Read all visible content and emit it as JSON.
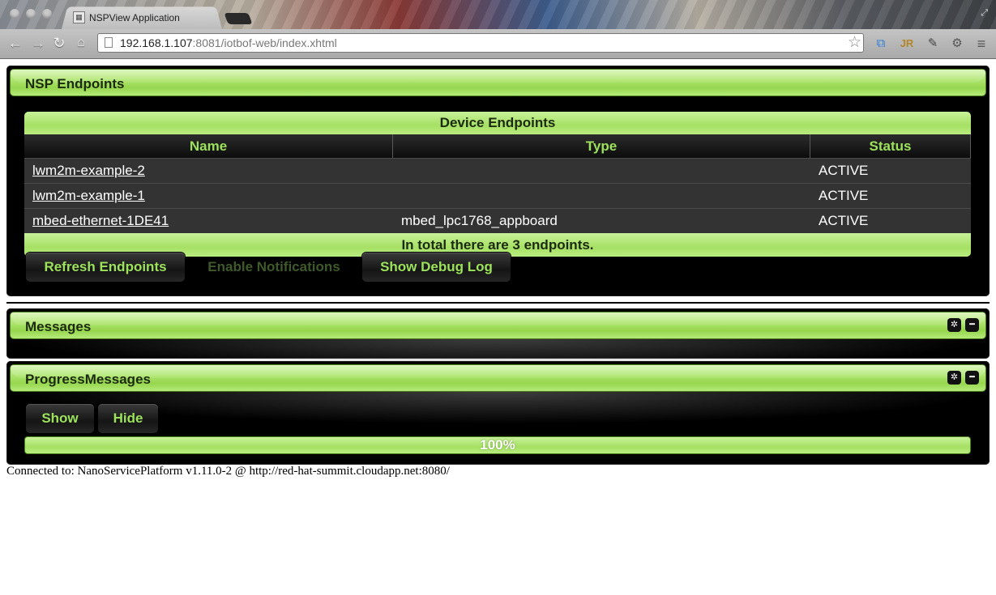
{
  "browser": {
    "tab_title": "NSPView Application",
    "url_host": "192.168.1.107",
    "url_rest": ":8081/iotbof-web/index.xhtml"
  },
  "endpoints_panel": {
    "title": "NSP Endpoints",
    "table_caption": "Device Endpoints",
    "columns": [
      "Name",
      "Type",
      "Status"
    ],
    "rows": [
      {
        "name": "lwm2m-example-2",
        "type": "",
        "status": "ACTIVE"
      },
      {
        "name": "lwm2m-example-1",
        "type": "",
        "status": "ACTIVE"
      },
      {
        "name": "mbed-ethernet-1DE41",
        "type": "mbed_lpc1768_appboard",
        "status": "ACTIVE"
      }
    ],
    "footer": "In total there are 3 endpoints.",
    "buttons": {
      "refresh": "Refresh Endpoints",
      "notifications": "Enable Notifications",
      "debug_log": "Show Debug Log"
    }
  },
  "messages_panel": {
    "title": "Messages"
  },
  "progress_panel": {
    "title": "ProgressMessages",
    "show_label": "Show",
    "hide_label": "Hide",
    "progress_text": "100%",
    "progress_value": 1.0
  },
  "status_line": "Connected to: NanoServicePlatform v1.11.0-2 @ http://red-hat-summit.cloudapp.net:8080/",
  "colors": {
    "accent_green": "#9ce25a",
    "header_green": "#aee56f",
    "panel_bg": "#000000"
  },
  "icons": [
    "back-icon",
    "forward-icon",
    "reload-icon",
    "home-icon",
    "bookmark-star-icon",
    "gear-icon",
    "minimize-icon",
    "menu-icon"
  ]
}
